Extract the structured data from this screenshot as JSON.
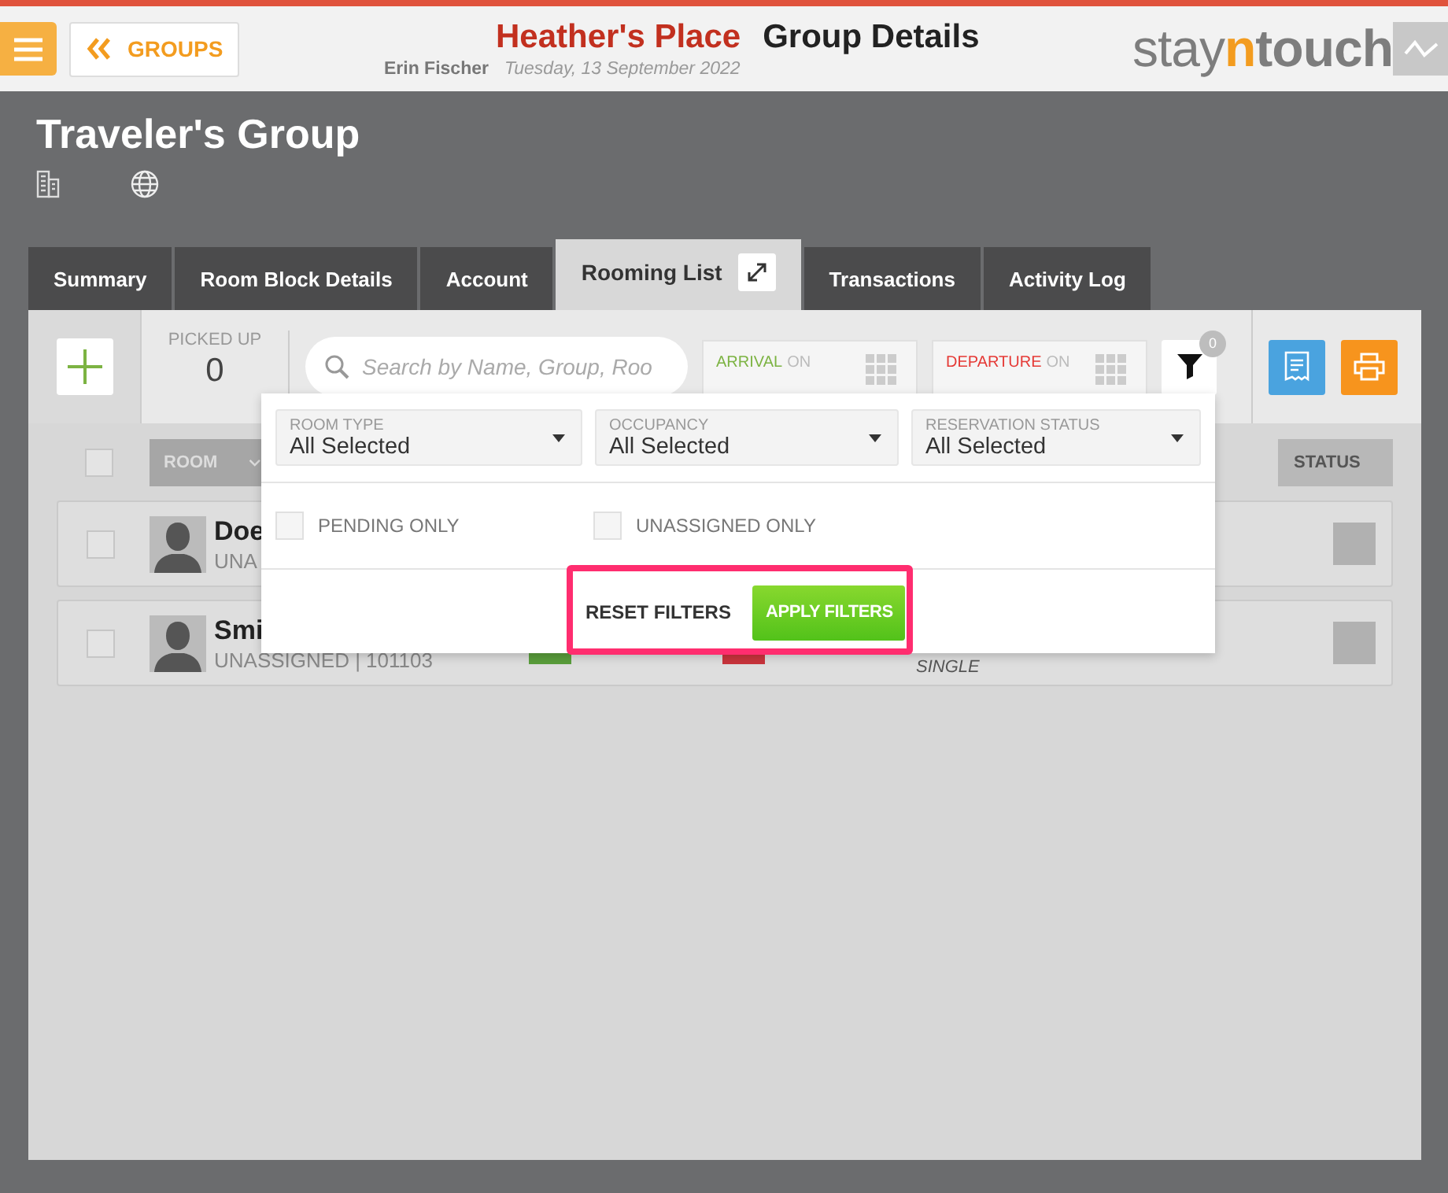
{
  "header": {
    "back_label": "GROUPS",
    "property": "Heather's Place",
    "page": "Group Details",
    "user": "Erin Fischer",
    "date": "Tuesday, 13 September 2022",
    "logo": [
      "stay",
      "n",
      "touch"
    ]
  },
  "group": {
    "title": "Traveler's Group"
  },
  "tabs": [
    {
      "label": "Summary",
      "selected": false
    },
    {
      "label": "Room Block Details",
      "selected": false
    },
    {
      "label": "Account",
      "selected": false
    },
    {
      "label": "Rooming List",
      "selected": true
    },
    {
      "label": "Transactions",
      "selected": false
    },
    {
      "label": "Activity Log",
      "selected": false
    }
  ],
  "toolbar": {
    "picked_up_label": "PICKED UP",
    "picked_up_value": "0",
    "search": {
      "placeholder": "Search by Name, Group, Roo"
    },
    "arrival": {
      "label": "ARRIVAL",
      "state": "ON"
    },
    "departure": {
      "label": "DEPARTURE",
      "state": "ON"
    },
    "filter_count": "0"
  },
  "table": {
    "select_all": {
      "checked": false
    },
    "columns": [
      "ROOM",
      "STATUS"
    ],
    "rows": [
      {
        "name": "Doe",
        "detail": "UNA",
        "checked": false
      },
      {
        "name": "Smi",
        "detail": "UNASSIGNED | 101103",
        "checked": false,
        "markers": [
          {
            "color": "#5a9e3c"
          },
          {
            "color": "#c8343c"
          }
        ],
        "room_type": "SINGLE"
      }
    ]
  },
  "filters": {
    "selects": [
      {
        "label": "ROOM TYPE",
        "value": "All Selected"
      },
      {
        "label": "OCCUPANCY",
        "value": "All Selected"
      },
      {
        "label": "RESERVATION STATUS",
        "value": "All Selected"
      }
    ],
    "checks": [
      {
        "label": "PENDING ONLY",
        "checked": false
      },
      {
        "label": "UNASSIGNED ONLY",
        "checked": false
      }
    ],
    "reset": "RESET FILTERS",
    "apply": "APPLY FILTERS"
  }
}
